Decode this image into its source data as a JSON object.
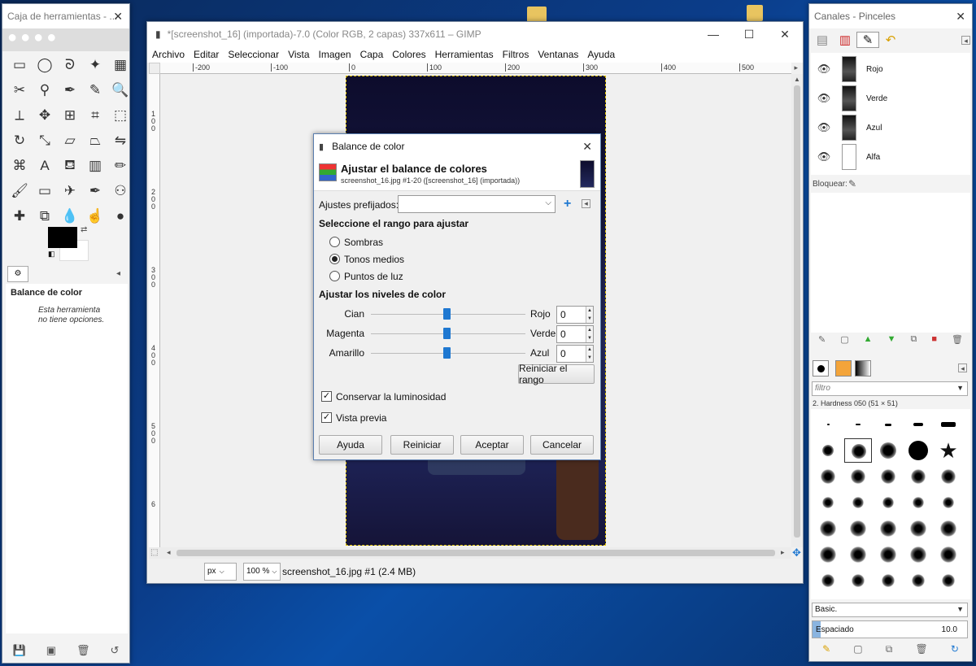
{
  "desktop": {
    "icons": [
      {
        "name": "folder-icon"
      },
      {
        "name": "folder-icon"
      }
    ]
  },
  "toolbox": {
    "title": "Caja de herramientas - ...",
    "tool_options_title": "Balance de color",
    "tool_options_text_1": "Esta herramienta",
    "tool_options_text_2": "no tiene opciones.",
    "fg_color": "#000000",
    "bg_color": "#ffffff"
  },
  "gimp": {
    "title": "*[screenshot_16] (importada)-7.0 (Color RGB, 2 capas) 337x611 – GIMP",
    "menu": [
      "Archivo",
      "Editar",
      "Seleccionar",
      "Vista",
      "Imagen",
      "Capa",
      "Colores",
      "Herramientas",
      "Filtros",
      "Ventanas",
      "Ayuda"
    ],
    "ruler_h": [
      "-200",
      "-100",
      "0",
      "100",
      "200",
      "300",
      "400",
      "500"
    ],
    "ruler_v": [
      "1",
      "0",
      "0",
      "2",
      "0",
      "0",
      "3",
      "0",
      "0",
      "4",
      "0",
      "0",
      "5",
      "0",
      "0",
      "6"
    ],
    "unit": "px",
    "zoom": "100 %",
    "status": "screenshot_16.jpg #1 (2.4 MB)"
  },
  "dialog": {
    "title": "Balance de color",
    "heading": "Ajustar el balance de colores",
    "subheading": "screenshot_16.jpg #1-20 ([screenshot_16] (importada))",
    "presets_label": "Ajustes prefijados:",
    "presets_value": "",
    "range_section": "Seleccione el rango para ajustar",
    "ranges": [
      "Sombras",
      "Tonos medios",
      "Puntos de luz"
    ],
    "selected_range": "Tonos medios",
    "levels_section": "Ajustar los niveles de color",
    "levels": [
      {
        "left": "Cian",
        "right": "Rojo",
        "value": "0"
      },
      {
        "left": "Magenta",
        "right": "Verde",
        "value": "0"
      },
      {
        "left": "Amarillo",
        "right": "Azul",
        "value": "0"
      }
    ],
    "reset_range": "Reiniciar el rango",
    "preserve_luminosity": "Conservar la luminosidad",
    "preview": "Vista previa",
    "buttons": {
      "help": "Ayuda",
      "reset": "Reiniciar",
      "ok": "Aceptar",
      "cancel": "Cancelar"
    }
  },
  "channels": {
    "title": "Canales - Pinceles",
    "rows": [
      "Rojo",
      "Verde",
      "Azul",
      "Alfa"
    ],
    "lock_label": "Bloquear:"
  },
  "brushes": {
    "filter_placeholder": "filtro",
    "selected": "2. Hardness 050 (51 × 51)",
    "preset": "Basic.",
    "spacing_label": "Espaciado",
    "spacing_value": "10.0"
  },
  "colors": {
    "accent": "#1f78d1",
    "desktop": "#0b3d8a"
  }
}
